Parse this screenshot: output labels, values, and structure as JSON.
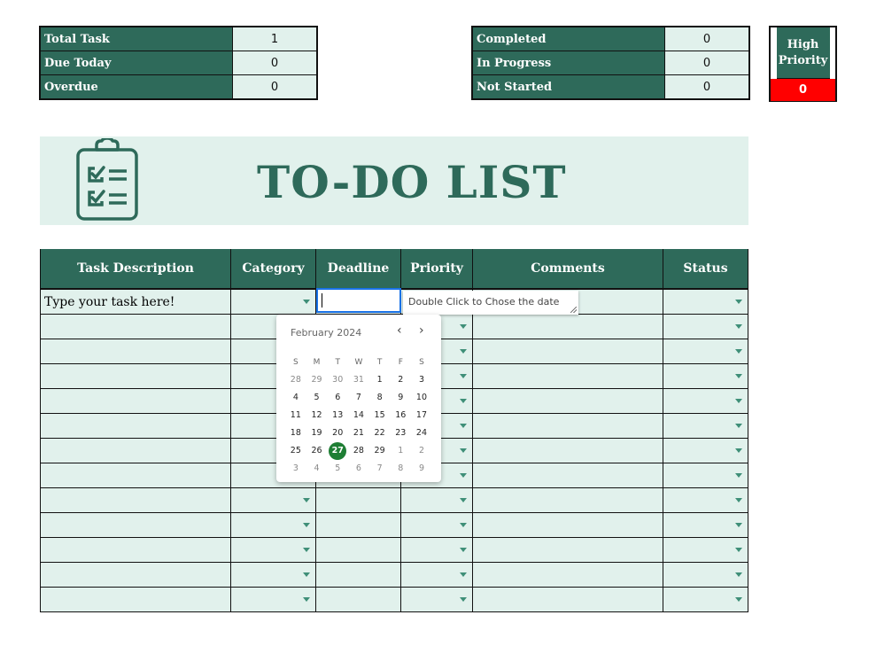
{
  "stats_left": [
    {
      "label": "Total Task",
      "value": "1"
    },
    {
      "label": "Due Today",
      "value": "0"
    },
    {
      "label": "Overdue",
      "value": "0"
    }
  ],
  "stats_right": [
    {
      "label": "Completed",
      "value": "0"
    },
    {
      "label": "In Progress",
      "value": "0"
    },
    {
      "label": "Not Started",
      "value": "0"
    }
  ],
  "high_priority": {
    "label": "High Priority",
    "value": "0"
  },
  "banner": {
    "title": "TO-DO LIST",
    "icon": "clipboard-checklist-icon"
  },
  "table": {
    "headers": [
      "Task Description",
      "Category",
      "Deadline",
      "Priority",
      "Comments",
      "Status"
    ],
    "first_task": "Type your task here!",
    "row_count": 13
  },
  "note": {
    "text": "Double Click to Chose the date"
  },
  "calendar": {
    "month": "February 2024",
    "weekdays": [
      "S",
      "M",
      "T",
      "W",
      "T",
      "F",
      "S"
    ],
    "weeks": [
      [
        "28",
        "29",
        "30",
        "31",
        "1",
        "2",
        "3"
      ],
      [
        "4",
        "5",
        "6",
        "7",
        "8",
        "9",
        "10"
      ],
      [
        "11",
        "12",
        "13",
        "14",
        "15",
        "16",
        "17"
      ],
      [
        "18",
        "19",
        "20",
        "21",
        "22",
        "23",
        "24"
      ],
      [
        "25",
        "26",
        "27",
        "28",
        "29",
        "1",
        "2"
      ],
      [
        "3",
        "4",
        "5",
        "6",
        "7",
        "8",
        "9"
      ]
    ],
    "selected": "27"
  },
  "colors": {
    "header_green": "#2e6a5a",
    "cell_mint": "#e1f1ec",
    "alert_red": "#ff0000",
    "selected_day": "#1e7e34"
  }
}
